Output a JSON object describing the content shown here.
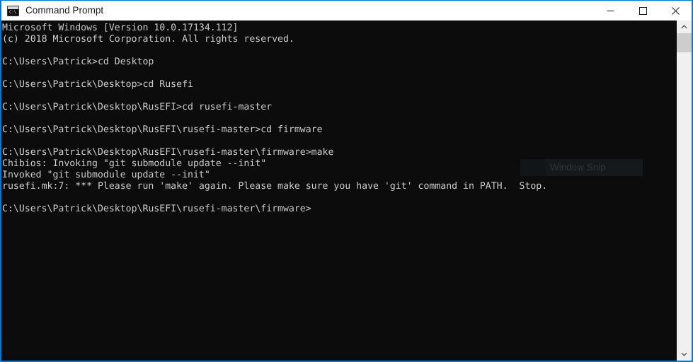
{
  "window": {
    "title": "Command Prompt",
    "icon_name": "command-prompt-icon",
    "icon_glyph": "C:\\",
    "border_color": "#0078d7",
    "titlebar_bg": "#ffffff",
    "titlebar_fg": "#1a1a1a"
  },
  "caption_buttons": [
    {
      "name": "minimize-button",
      "label": "Minimize",
      "glyph": "minimize-icon"
    },
    {
      "name": "maximize-button",
      "label": "Maximize",
      "glyph": "maximize-icon"
    },
    {
      "name": "close-button",
      "label": "Close",
      "glyph": "close-icon"
    }
  ],
  "console": {
    "background": "#0c0c0c",
    "foreground": "#cccccc",
    "lines": [
      "Microsoft Windows [Version 10.0.17134.112]",
      "(c) 2018 Microsoft Corporation. All rights reserved.",
      "",
      "C:\\Users\\Patrick>cd Desktop",
      "",
      "C:\\Users\\Patrick\\Desktop>cd Rusefi",
      "",
      "C:\\Users\\Patrick\\Desktop\\RusEFI>cd rusefi-master",
      "",
      "C:\\Users\\Patrick\\Desktop\\RusEFI\\rusefi-master>cd firmware",
      "",
      "C:\\Users\\Patrick\\Desktop\\RusEFI\\rusefi-master\\firmware>make",
      "Chibios: Invoking \"git submodule update --init\"",
      "Invoked \"git submodule update --init\"",
      "rusefi.mk:7: *** Please run 'make' again. Please make sure you have 'git' command in PATH.  Stop.",
      "",
      "C:\\Users\\Patrick\\Desktop\\RusEFI\\rusefi-master\\firmware>"
    ]
  },
  "snip_overlay": {
    "label": "Window Snip",
    "background": "#16191c",
    "text_color": "#2e3336"
  },
  "scrollbar": {
    "up_arrow": "chevron-up-icon",
    "down_arrow": "chevron-down-icon",
    "track_color": "#f0f0f0",
    "thumb_color": "#cdcdcd"
  }
}
